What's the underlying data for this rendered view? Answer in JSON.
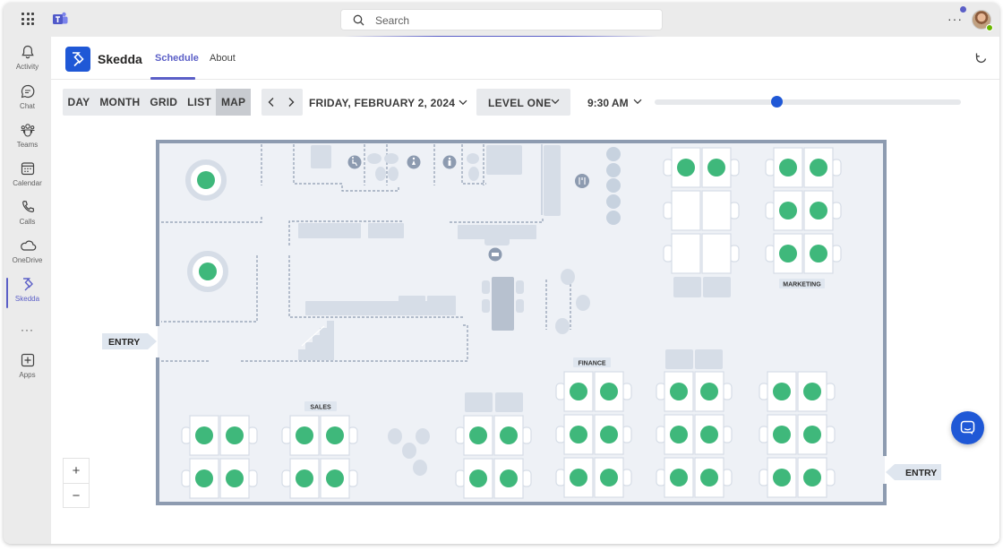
{
  "teams": {
    "search_placeholder": "Search",
    "more_label": "···",
    "rail": [
      {
        "label": "Activity",
        "icon": "bell-icon"
      },
      {
        "label": "Chat",
        "icon": "chat-icon"
      },
      {
        "label": "Teams",
        "icon": "teams-icon"
      },
      {
        "label": "Calendar",
        "icon": "calendar-icon"
      },
      {
        "label": "Calls",
        "icon": "phone-icon"
      },
      {
        "label": "OneDrive",
        "icon": "cloud-icon"
      },
      {
        "label": "Skedda",
        "icon": "skedda-icon"
      },
      {
        "label": "Apps",
        "icon": "plus-icon"
      }
    ],
    "rail_more": "···",
    "accent_color": "#5b5fc7"
  },
  "app": {
    "title": "Skedda",
    "tabs": [
      {
        "label": "Schedule",
        "active": true
      },
      {
        "label": "About",
        "active": false
      }
    ],
    "brand_color": "#1f58d6"
  },
  "toolbar": {
    "views": [
      {
        "label": "DAY",
        "active": false
      },
      {
        "label": "MONTH",
        "active": false
      },
      {
        "label": "GRID",
        "active": false
      },
      {
        "label": "LIST",
        "active": false
      },
      {
        "label": "MAP",
        "active": true
      }
    ],
    "date": "FRIDAY, FEBRUARY 2, 2024",
    "level": "LEVEL ONE",
    "time": "9:30 AM"
  },
  "map": {
    "labels": {
      "entry_left": "ENTRY",
      "entry_right": "ENTRY",
      "marketing": "MARKETING",
      "finance": "FINANCE",
      "sales": "SALES"
    },
    "available_color": "#3fb87b",
    "zoom_in": "+",
    "zoom_out": "−"
  }
}
